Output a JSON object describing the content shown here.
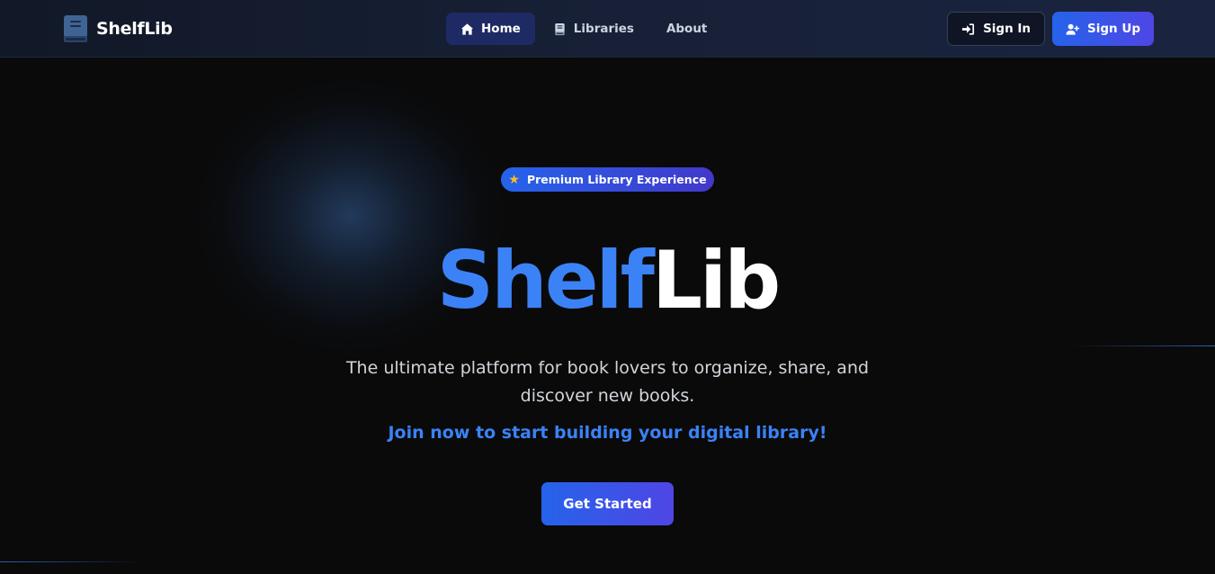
{
  "brand": {
    "name": "ShelfLib",
    "icon": "book-icon"
  },
  "nav": {
    "items": [
      {
        "label": "Home",
        "icon": "home-icon",
        "active": true
      },
      {
        "label": "Libraries",
        "icon": "book-icon",
        "active": false
      },
      {
        "label": "About",
        "icon": "",
        "active": false
      }
    ]
  },
  "auth": {
    "signin_label": "Sign In",
    "signin_icon": "sign-in-icon",
    "signup_label": "Sign Up",
    "signup_icon": "user-plus-icon"
  },
  "hero": {
    "badge": "Premium Library Experience",
    "badge_icon": "star-icon",
    "title_part1": "Shelf",
    "title_part2": "Lib",
    "subtitle": "The ultimate platform for book lovers to organize, share, and discover new books.",
    "cta_text": "Join now to start building your digital library!",
    "button_label": "Get Started"
  },
  "colors": {
    "background": "#0a0a0a",
    "accent": "#3b82f6",
    "gradient_start": "#2563eb",
    "gradient_end": "#4f46e5"
  }
}
